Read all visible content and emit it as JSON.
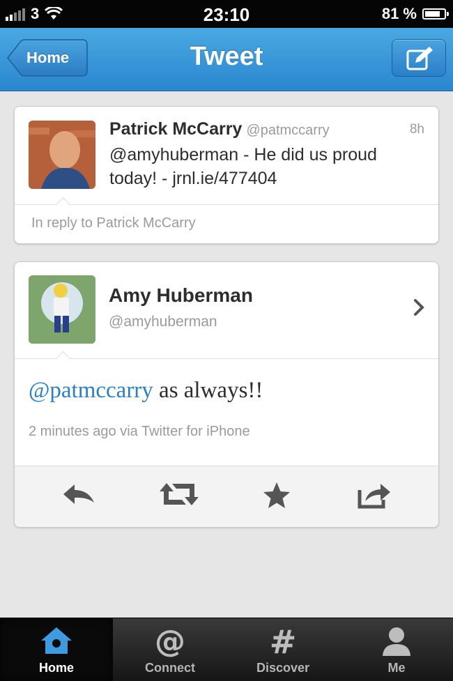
{
  "status_bar": {
    "carrier": "3",
    "time": "23:10",
    "battery_text": "81 %",
    "battery_level": 0.81
  },
  "nav": {
    "back_label": "Home",
    "title": "Tweet",
    "compose_icon": "compose-icon"
  },
  "replied_tweet": {
    "author_name": "Patrick McCarry",
    "author_handle": "@patmccarry",
    "age": "8h",
    "text": "@amyhuberman - He did us proud today! -  jrnl.ie/477404",
    "reply_label": "In reply to Patrick McCarry"
  },
  "tweet": {
    "author_name": "Amy Huberman",
    "author_handle": "@amyhuberman",
    "mention": "@patmccarry",
    "text_rest": " as always!!",
    "meta": "2 minutes ago via Twitter for iPhone"
  },
  "actions": [
    "reply-icon",
    "retweet-icon",
    "favorite-star-icon",
    "share-icon"
  ],
  "tabs": [
    {
      "label": "Home",
      "icon": "home-icon",
      "active": true
    },
    {
      "label": "Connect",
      "icon": "at-sign-icon",
      "active": false
    },
    {
      "label": "Discover",
      "icon": "hashtag-icon",
      "active": false
    },
    {
      "label": "Me",
      "icon": "person-icon",
      "active": false
    }
  ],
  "colors": {
    "nav_blue": "#2a86cf",
    "mention_blue": "#2b80c4",
    "active_tab_icon": "#3f9be0"
  }
}
